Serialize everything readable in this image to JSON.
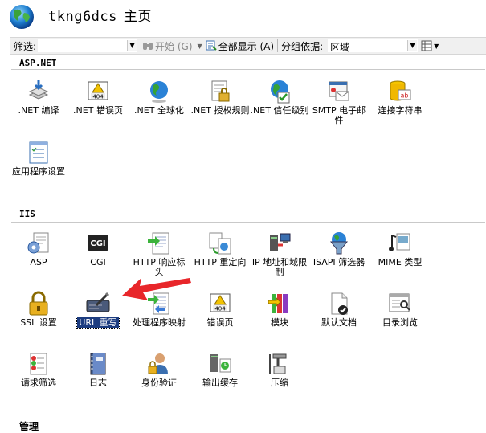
{
  "header": {
    "site_name": "tkng6dcs",
    "title_suffix": "主页"
  },
  "toolbar": {
    "filter_label": "筛选:",
    "filter_value": "",
    "start_label": "开始 (G)",
    "show_all_label": "全部显示 (A)",
    "group_by_label": "分组依据:",
    "group_by_value": "区域"
  },
  "sections": [
    {
      "title": "ASP.NET",
      "items": [
        {
          "label": ".NET 编译",
          "icon": "net-compilation-icon"
        },
        {
          "label": ".NET 错误页",
          "icon": "net-error-pages-icon"
        },
        {
          "label": ".NET 全球化",
          "icon": "net-globalization-icon"
        },
        {
          "label": ".NET 授权规则",
          "icon": "net-authorization-icon"
        },
        {
          "label": ".NET 信任级别",
          "icon": "net-trust-levels-icon"
        },
        {
          "label": "SMTP 电子邮件",
          "icon": "smtp-email-icon"
        },
        {
          "label": "连接字符串",
          "icon": "connection-strings-icon"
        },
        {
          "label": "应用程序设置",
          "icon": "app-settings-icon"
        }
      ]
    },
    {
      "title": "IIS",
      "items": [
        {
          "label": "ASP",
          "icon": "asp-icon"
        },
        {
          "label": "CGI",
          "icon": "cgi-icon"
        },
        {
          "label": "HTTP 响应标头",
          "icon": "http-response-headers-icon"
        },
        {
          "label": "HTTP 重定向",
          "icon": "http-redirect-icon"
        },
        {
          "label": "IP 地址和域限制",
          "icon": "ip-domain-restrictions-icon"
        },
        {
          "label": "ISAPI 筛选器",
          "icon": "isapi-filters-icon"
        },
        {
          "label": "MIME 类型",
          "icon": "mime-types-icon"
        },
        {
          "label": "SSL 设置",
          "icon": "ssl-settings-icon"
        },
        {
          "label": "URL 重写",
          "icon": "url-rewrite-icon"
        },
        {
          "label": "处理程序映射",
          "icon": "handler-mappings-icon"
        },
        {
          "label": "错误页",
          "icon": "error-pages-icon"
        },
        {
          "label": "模块",
          "icon": "modules-icon"
        },
        {
          "label": "默认文档",
          "icon": "default-document-icon"
        },
        {
          "label": "目录浏览",
          "icon": "directory-browsing-icon"
        },
        {
          "label": "请求筛选",
          "icon": "request-filtering-icon"
        },
        {
          "label": "日志",
          "icon": "logging-icon"
        },
        {
          "label": "身份验证",
          "icon": "authentication-icon"
        },
        {
          "label": "输出缓存",
          "icon": "output-caching-icon"
        },
        {
          "label": "压缩",
          "icon": "compression-icon"
        }
      ]
    },
    {
      "title": "管理",
      "items": []
    }
  ],
  "icon_labels": {
    "cgi_text": "CGI",
    "num_404": "404",
    "ab_text": "ab"
  },
  "colors": {
    "selection": "#1c3c80",
    "arrow": "#e8262a",
    "section_line": "#c9c9c9"
  }
}
